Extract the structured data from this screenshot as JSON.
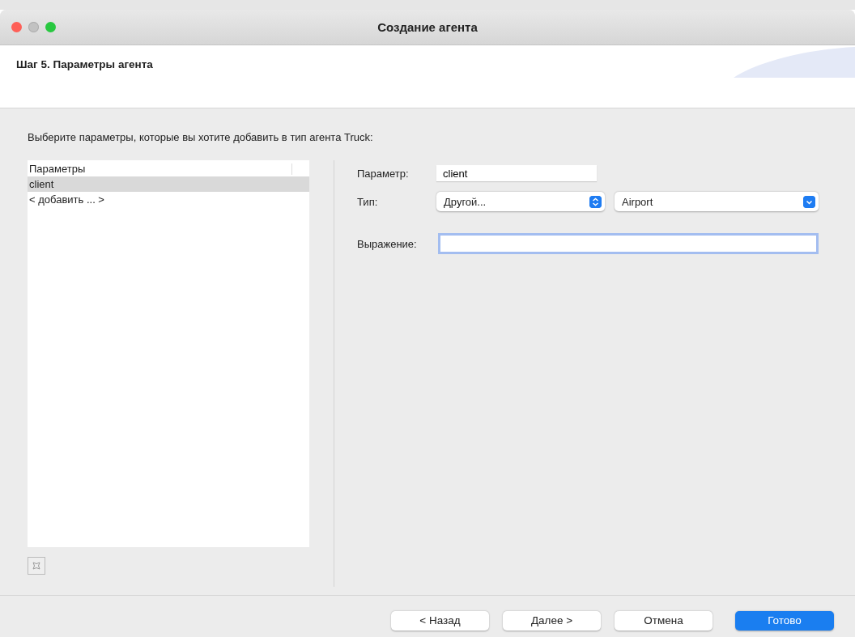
{
  "window": {
    "title": "Создание агента"
  },
  "header": {
    "title": "Шаг 5. Параметры агента"
  },
  "instruction": "Выберите параметры, которые вы хотите добавить в тип агента Truck:",
  "parameters_list": {
    "column": "Параметры",
    "items": [
      {
        "label": "client",
        "selected": true
      },
      {
        "label": "< добавить ... >",
        "selected": false
      }
    ]
  },
  "form": {
    "parameter_label": "Параметр:",
    "parameter_value": "client",
    "type_label": "Тип:",
    "type_value": "Другой...",
    "type_class": "Airport",
    "expression_label": "Выражение:",
    "expression_focused": true
  },
  "buttons": [
    {
      "label": "< Назад",
      "default": false
    },
    {
      "label": "Далее >",
      "default": false
    },
    {
      "label": "Отмена",
      "default": false
    },
    {
      "label": "Готово",
      "default": true
    }
  ]
}
